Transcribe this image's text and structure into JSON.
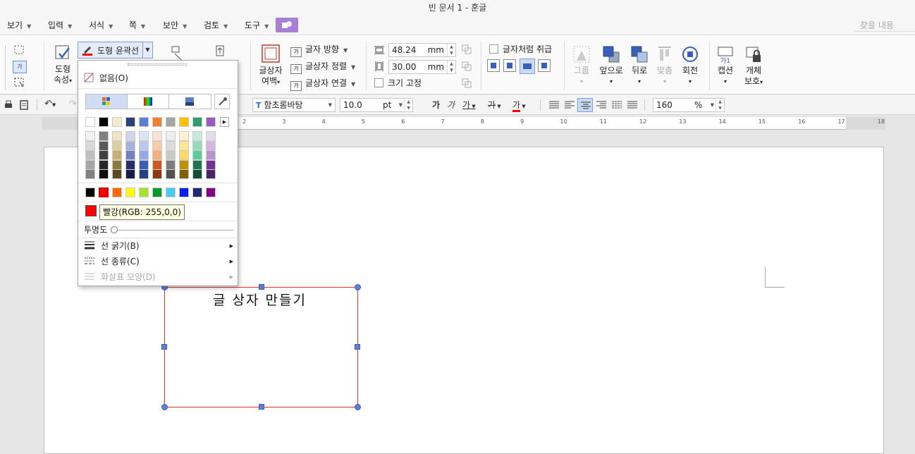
{
  "window": {
    "title": "빈 문서 1 - 훈글"
  },
  "menu": {
    "items": [
      "보기",
      "입력",
      "서식",
      "쪽",
      "보안",
      "검토",
      "도구"
    ],
    "find_placeholder": "찾을 내용"
  },
  "ribbon": {
    "shape_props": "도형\n속성",
    "shape_props_l1": "도형",
    "shape_props_l2": "속성",
    "outline_button": "도형 윤곽선",
    "textbox_margin_l1": "글상자",
    "textbox_margin_l2": "여백",
    "text_direction": "글자 방향",
    "textbox_align": "글상자 정렬",
    "textbox_link": "글상자 연결",
    "width_value": "48.24",
    "height_value": "30.00",
    "unit_mm": "mm",
    "fix_size": "크기 고정",
    "treat_as_char": "글자처럼 취급",
    "group": "그룹",
    "bring_front": "앞으로",
    "send_back": "뒤로",
    "align": "맞춤",
    "rotate": "회전",
    "caption": "캡션",
    "protect_l1": "개체",
    "protect_l2": "보호"
  },
  "toolbar2": {
    "font_name": "함초롬바탕",
    "font_size": "10.0",
    "font_unit": "pt",
    "zoom": "160",
    "zoom_unit": "%",
    "char_a1": "가",
    "char_a2": "가",
    "char_a3": "가",
    "char_a4": "가",
    "char_a5": "가"
  },
  "ruler": {
    "numbers": [
      "2",
      "3",
      "4",
      "5",
      "6",
      "7",
      "8",
      "9",
      "10",
      "11",
      "12",
      "13",
      "14",
      "15",
      "16",
      "17",
      "18"
    ]
  },
  "document": {
    "textbox_text": "글 상자 만들기"
  },
  "popup": {
    "none_label": "없음(O)",
    "opacity_label": "투명도",
    "line_width": "선 굵기(B)",
    "line_type": "선 종류(C)",
    "arrow_shape": "화살표 모양(D)",
    "tooltip": "빨강(RGB: 255,0,0)",
    "palette_top": [
      "#ffffff",
      "#000000",
      "#f2ead2",
      "#2f3f7e",
      "#5b7fd4",
      "#f07f30",
      "#a5a5a5",
      "#ffc000",
      "#2f9e6e",
      "#9a5bbf"
    ],
    "palette_cols": [
      [
        "#f2f2f2",
        "#d9d9d9",
        "#bfbfbf",
        "#a6a6a6",
        "#808080"
      ],
      [
        "#808080",
        "#595959",
        "#404040",
        "#262626",
        "#0d0d0d"
      ],
      [
        "#efe5c5",
        "#ddd0a0",
        "#c7b070",
        "#8d7740",
        "#5a4a20"
      ],
      [
        "#d0d4ea",
        "#a8b0d8",
        "#7480c0",
        "#28306a",
        "#181e48"
      ],
      [
        "#dbe3f5",
        "#b9c8ee",
        "#94a9e5",
        "#3a5fb8",
        "#253f80"
      ],
      [
        "#fbe4d5",
        "#f8caa8",
        "#f4ae7a",
        "#d0581a",
        "#8a3a10"
      ],
      [
        "#ededed",
        "#dbdbdb",
        "#c9c9c9",
        "#7c7c7c",
        "#525252"
      ],
      [
        "#fff2cc",
        "#ffe699",
        "#ffd966",
        "#bf9000",
        "#7f6000"
      ],
      [
        "#c7ecdc",
        "#94dbbb",
        "#5fca9a",
        "#207550",
        "#154d35"
      ],
      [
        "#e7dbf0",
        "#cfb7e2",
        "#b894d3",
        "#70368f",
        "#4a2460"
      ]
    ],
    "standard": [
      "#000000",
      "#ff0000",
      "#ff6a00",
      "#ffff00",
      "#a6e22e",
      "#009a2a",
      "#4ccaf0",
      "#0022ee",
      "#1f2870",
      "#800080"
    ],
    "current": "#ff0000"
  },
  "colors": {
    "accent": "#a97fd6",
    "outline": "#e03030",
    "handle": "#5b7fd4"
  }
}
